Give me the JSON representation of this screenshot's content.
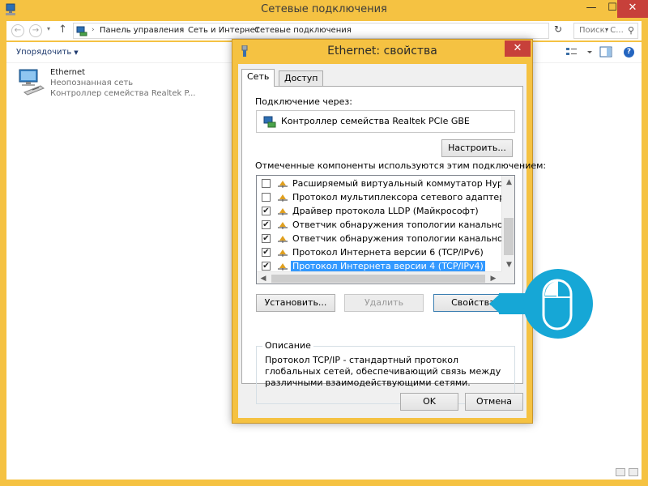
{
  "window": {
    "title": "Сетевые подключения",
    "minimize_glyph": "—",
    "maximize_glyph": "☐",
    "close_glyph": "✕"
  },
  "address_bar": {
    "back_glyph": "←",
    "forward_glyph": "→",
    "dropdown_glyph": "▾",
    "up_glyph": "↑",
    "breadcrumbs": [
      "Панель управления",
      "Сеть и Интернет",
      "Сетевые подключения"
    ],
    "separator": "›",
    "refresh_glyph": "↻",
    "search_placeholder": "Поиск: С...",
    "search_glyph": "⚲"
  },
  "toolbar": {
    "organize_label": "Упорядочить",
    "organize_arrow": "▼",
    "help_glyph": "?"
  },
  "connection": {
    "name": "Ethernet",
    "status": "Неопознанная сеть",
    "adapter": "Контроллер семейства Realtek P..."
  },
  "dialog": {
    "title": "Ethernet: свойства",
    "close_glyph": "✕",
    "tabs": [
      "Сеть",
      "Доступ"
    ],
    "connect_using_label": "Подключение через:",
    "adapter_name": "Контроллер семейства Realtek PCIe GBE",
    "configure_button": "Настроить...",
    "components_label": "Отмеченные компоненты используются этим подключением:",
    "components": [
      {
        "label": "Расширяемый виртуальный коммутатор Hyper-V",
        "checked": false,
        "selected": false
      },
      {
        "label": "Протокол мультиплексора сетевого адаптера (Ма",
        "checked": false,
        "selected": false
      },
      {
        "label": "Драйвер протокола LLDP (Майкрософт)",
        "checked": true,
        "selected": false
      },
      {
        "label": "Ответчик обнаружения топологии канального уров",
        "checked": true,
        "selected": false
      },
      {
        "label": "Ответчик обнаружения топологии канального уров",
        "checked": true,
        "selected": false
      },
      {
        "label": "Протокол Интернета версии 6 (TCP/IPv6)",
        "checked": true,
        "selected": false
      },
      {
        "label": "Протокол Интернета версии 4 (TCP/IPv4)",
        "checked": true,
        "selected": true
      }
    ],
    "check_glyph": "✔",
    "scroll_up_glyph": "▲",
    "scroll_down_glyph": "▼",
    "scroll_left_glyph": "◀",
    "scroll_right_glyph": "▶",
    "install_button": "Установить...",
    "uninstall_button": "Удалить",
    "properties_button": "Свойства",
    "description_legend": "Описание",
    "description_text": "Протокол TCP/IP - стандартный протокол глобальных сетей, обеспечивающий связь между различными взаимодействующими сетями.",
    "ok_button": "OK",
    "cancel_button": "Отмена"
  },
  "colors": {
    "window_frame": "#f5c242",
    "close_red": "#c7403a",
    "callout_blue": "#16a7d6",
    "selection_blue": "#3399ff"
  }
}
